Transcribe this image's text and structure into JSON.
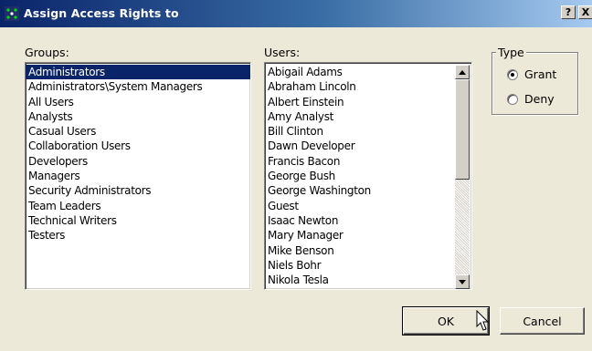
{
  "window": {
    "title": "Assign Access Rights to",
    "help_label": "?",
    "close_label": "X"
  },
  "groups": {
    "label": "Groups:",
    "selected_index": 0,
    "items": [
      "Administrators",
      "Administrators\\System Managers",
      "All Users",
      "Analysts",
      "Casual Users",
      "Collaboration Users",
      "Developers",
      "Managers",
      "Security Administrators",
      "Team Leaders",
      "Technical Writers",
      "Testers"
    ]
  },
  "users": {
    "label": "Users:",
    "items": [
      "Abigail Adams",
      "Abraham Lincoln",
      "Albert Einstein",
      "Amy Analyst",
      "Bill Clinton",
      "Dawn Developer",
      "Francis Bacon",
      "George Bush",
      "George Washington",
      "Guest",
      "Isaac Newton",
      "Mary Manager",
      "Mike Benson",
      "Niels Bohr",
      "Nikola Tesla"
    ]
  },
  "type": {
    "label": "Type",
    "options": [
      "Grant",
      "Deny"
    ],
    "selected": "Grant"
  },
  "buttons": {
    "ok": "OK",
    "cancel": "Cancel"
  },
  "icons": {
    "app": "app-icon",
    "scroll_up": "scroll-up-arrow-icon",
    "scroll_down": "scroll-down-arrow-icon",
    "cursor": "mouse-pointer-icon"
  },
  "colors": {
    "titlebar_start": "#0a246a",
    "titlebar_end": "#a6caf0",
    "selection": "#0a246a",
    "dialog_face": "#ece9d8"
  }
}
